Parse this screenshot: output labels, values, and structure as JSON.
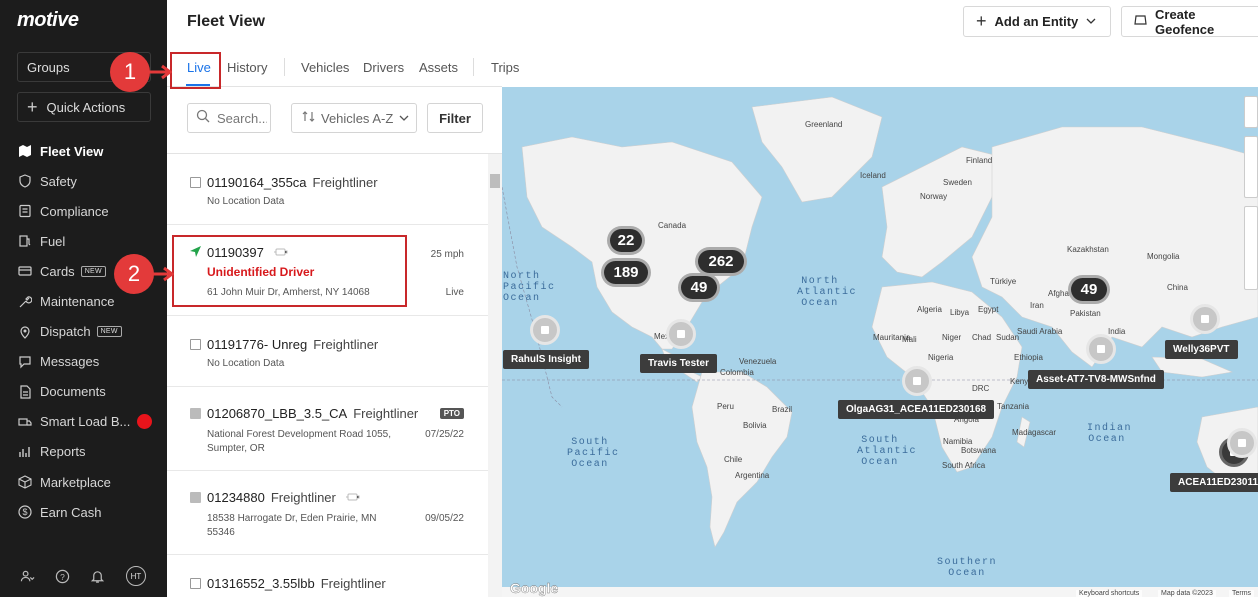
{
  "app": {
    "logo": "motive"
  },
  "sidebar": {
    "groups_label": "Groups",
    "quick_actions": "Quick Actions",
    "items": [
      {
        "label": "Fleet View",
        "icon": "map-icon",
        "active": true
      },
      {
        "label": "Safety",
        "icon": "shield-icon"
      },
      {
        "label": "Compliance",
        "icon": "clipboard-icon"
      },
      {
        "label": "Fuel",
        "icon": "fuel-icon"
      },
      {
        "label": "Cards",
        "icon": "card-icon",
        "badge": "NEW"
      },
      {
        "label": "Maintenance",
        "icon": "wrench-icon"
      },
      {
        "label": "Dispatch",
        "icon": "location-icon",
        "badge": "NEW"
      },
      {
        "label": "Messages",
        "icon": "chat-icon"
      },
      {
        "label": "Documents",
        "icon": "document-icon"
      },
      {
        "label": "Smart Load B...",
        "icon": "truck-icon",
        "dot": true
      },
      {
        "label": "Reports",
        "icon": "chart-icon"
      },
      {
        "label": "Marketplace",
        "icon": "box-icon"
      },
      {
        "label": "Earn Cash",
        "icon": "dollar-icon"
      }
    ],
    "avatar_initials": "HT"
  },
  "header": {
    "title": "Fleet View",
    "add_entity": "Add an Entity",
    "create_geofence": "Create Geofence"
  },
  "tabs": [
    "Live",
    "History",
    "Vehicles",
    "Drivers",
    "Assets",
    "Trips"
  ],
  "toolbar": {
    "search_placeholder": "Search...",
    "sort_label": "Vehicles A-Z",
    "filter_label": "Filter"
  },
  "vehicles": [
    {
      "id": "01190164_355ca",
      "make": "Freightliner",
      "sub": "No Location Data"
    },
    {
      "id": "01190397",
      "driver": "Unidentified Driver",
      "address": "61 John Muir Dr, Amherst, NY 14068",
      "speed": "25 mph",
      "status": "Live"
    },
    {
      "id": "01191776- Unreg",
      "make": "Freightliner",
      "sub": "No Location Data"
    },
    {
      "id": "01206870_LBB_3.5_CA",
      "make": "Freightliner",
      "badge": "PTO",
      "address": "National Forest Development Road 1055, Sumpter, OR",
      "date": "07/25/22"
    },
    {
      "id": "01234880",
      "make": "Freightliner",
      "address": "18538 Harrogate Dr, Eden Prairie, MN 55346",
      "date": "09/05/22"
    },
    {
      "id": "01316552_3.55lbb",
      "make": "Freightliner"
    }
  ],
  "map": {
    "clusters": [
      "22",
      "189",
      "262",
      "49",
      "49"
    ],
    "tags": [
      "RahulS Insight",
      "Travis Tester",
      "OlgaAG31_ACEA11ED230168",
      "Asset-AT7-TV8-MWSnfnd",
      "Welly36PVT",
      "ACEA11ED23011"
    ],
    "oceans": {
      "north_pacific": "North\nPacific\nOcean",
      "north_atlantic": "North\nAtlantic\nOcean",
      "south_pacific": "South\nPacific\nOcean",
      "south_atlantic": "South\nAtlantic\nOcean",
      "indian": "Indian\nOcean",
      "southern": "Southern\nOcean"
    },
    "places": [
      "Greenland",
      "Finland",
      "Iceland",
      "Sweden",
      "Norway",
      "Canada",
      "Kazakhstan",
      "Mongolia",
      "China",
      "Türkiye",
      "Afghanistan",
      "Iran",
      "Pakistan",
      "Libya",
      "Egypt",
      "Algeria",
      "Saudi Arabia",
      "India",
      "Mexico",
      "Venezuela",
      "Colombia",
      "Brazil",
      "Peru",
      "Bolivia",
      "Chile",
      "Argentina",
      "Niger",
      "Chad",
      "Sudan",
      "Nigeria",
      "Ethiopia",
      "Kenya",
      "DRC",
      "Tanzania",
      "Angola",
      "Namibia",
      "Botswana",
      "South Africa",
      "Madagascar",
      "Mali",
      "Mauritania"
    ],
    "attribution": [
      "Keyboard shortcuts",
      "Map data ©2023",
      "Terms"
    ],
    "google": "Google"
  },
  "annotations": [
    "1",
    "2"
  ]
}
